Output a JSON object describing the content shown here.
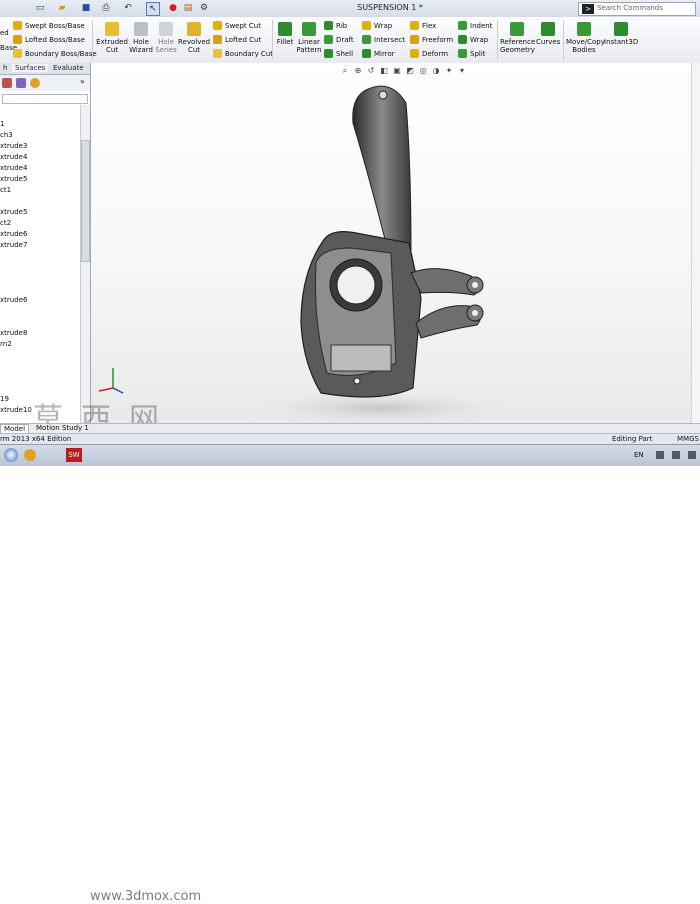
{
  "title_bar": {
    "document_title": "SUSPENSION 1 *",
    "search_placeholder": "Search Commands"
  },
  "ribbon": {
    "boss_base": [
      "Swept Boss/Base",
      "Lofted Boss/Base",
      "Boundary Boss/Base"
    ],
    "left_cut_labels": [
      "ed",
      "Base"
    ],
    "extruded_cut": "Extruded Cut",
    "hole_wizard": "Hole Wizard",
    "hole_series": "Hole Series",
    "revolved_cut": "Revolved Cut",
    "cuts": [
      "Swept Cut",
      "Lofted Cut",
      "Boundary Cut"
    ],
    "fillet": "Fillet",
    "linear_pattern": "Linear Pattern",
    "features_col1": [
      "Rib",
      "Draft",
      "Shell"
    ],
    "features_col2": [
      "Wrap",
      "Intersect",
      "Mirror"
    ],
    "features_col3": [
      "Flex",
      "Freeform",
      "Deform"
    ],
    "features_col4": [
      "Indent",
      "Wrap",
      "Split"
    ],
    "reference_geometry": "Reference Geometry",
    "curves": "Curves",
    "move_copy": "Move/Copy Bodies",
    "instant3d": "Instant3D"
  },
  "feature_manager": {
    "tabs": [
      "h",
      "Surfaces",
      "Evaluate"
    ],
    "tree": [
      "1",
      "ch3",
      "xtrude3",
      "xtrude4",
      "xtrude4",
      "xtrude5",
      "ct1",
      "xtrude5",
      "ct2",
      "xtrude6",
      "xtrude7",
      "xtrude6",
      "xtrude8",
      "rn2",
      "19",
      "xtrude10"
    ]
  },
  "bottom_tabs": [
    "Model",
    "Motion Study 1"
  ],
  "status": {
    "edition": "rm 2013 x64 Edition",
    "mode": "Editing Part",
    "units": "MMGS"
  },
  "taskbar": {
    "lang": "EN"
  },
  "watermark": {
    "cn": "莫西网",
    "url": "www.3dmox.com"
  },
  "colors": {
    "ribbon_bg": "#eef1f5",
    "accent_green": "#2e8b2e",
    "accent_yellow": "#e0b010",
    "part_dark": "#3a3a3a"
  }
}
